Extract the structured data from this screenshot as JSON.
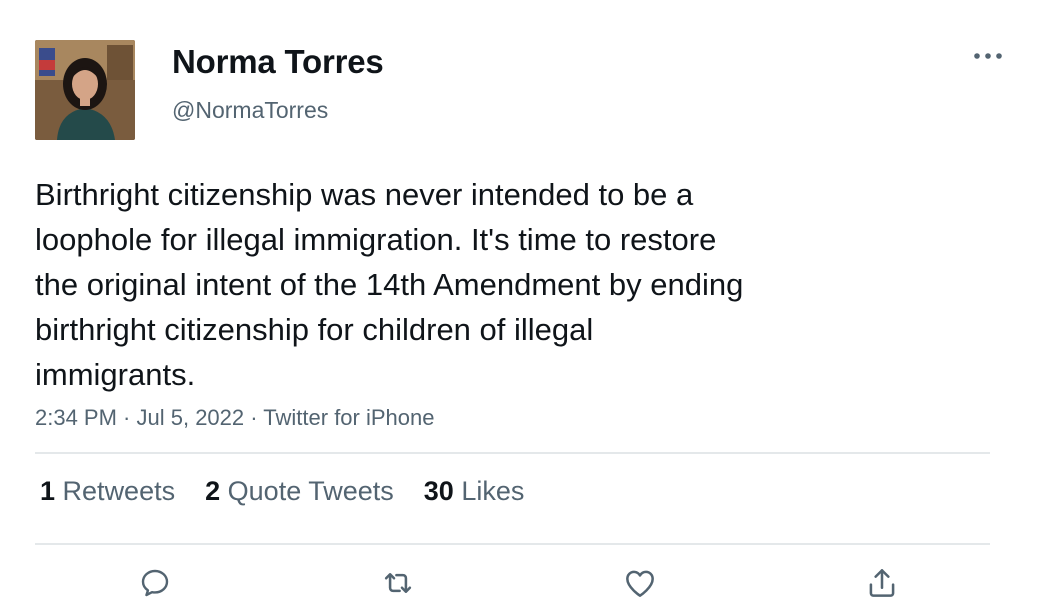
{
  "author": {
    "name": "Norma Torres",
    "handle": "@NormaTorres"
  },
  "tweet": {
    "text": "Birthright citizenship was never intended to be a\nloophole for illegal immigration. It's time to restore\nthe original intent of the 14th Amendment by ending\nbirthright citizenship for children of illegal\nimmigrants.",
    "time": "2:34 PM",
    "date": "Jul 5, 2022",
    "source": "Twitter for iPhone",
    "separator": " · "
  },
  "stats": {
    "retweets": {
      "count": "1",
      "label": "Retweets"
    },
    "quotes": {
      "count": "2",
      "label": "Quote Tweets"
    },
    "likes": {
      "count": "30",
      "label": "Likes"
    }
  },
  "icons": {
    "more": "more-horizontal-icon",
    "reply": "reply-icon",
    "retweet": "retweet-icon",
    "like": "heart-icon",
    "share": "share-icon"
  },
  "colors": {
    "text": "#0f1419",
    "secondary": "#536471",
    "divider": "#e4e8ea"
  }
}
